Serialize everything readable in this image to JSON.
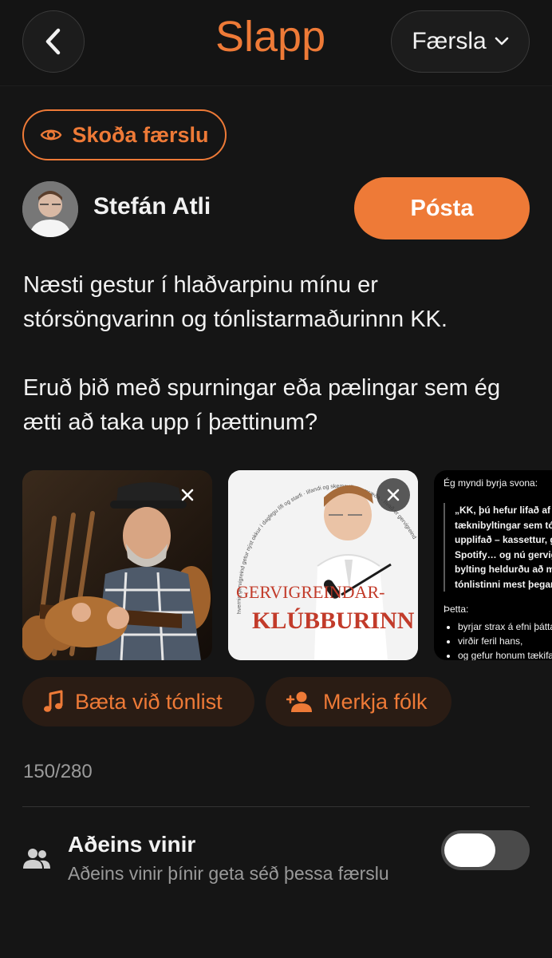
{
  "header": {
    "back_icon": "chevron-left-icon",
    "logo_text": "Slapp",
    "post_type_label": "Færsla",
    "dropdown_icon": "chevron-down-icon"
  },
  "composer": {
    "view_post_label": "Skoða færslu",
    "view_icon": "eye-icon",
    "author_name": "Stefán Atli",
    "post_button_label": "Pósta",
    "post_text": [
      "Næsti gestur í hlaðvarpinu mínu er stórsöngvarinn og tónlistarmaðurinnn KK.",
      "Eruð þið með spurningar eða pælingar sem ég ætti að taka upp í þættinum?"
    ],
    "attachments": {
      "podcast_cover": {
        "title_line1": "GERVIGREINDAR-",
        "title_line2": "KLÚBBURINN",
        "arc_text": "hvernig gervigreind getur nýst okkur í daglegu lífi og starfi · lifandi og skemmtileg umræða · hvað er gervigreind?"
      },
      "text_screenshot": {
        "intro": "Ég myndi byrja svona:",
        "quote_lines": [
          "„KK, þú hefur lifað af all",
          "tæknibyltingar sem tónl",
          "upplifað – kassettur, gei",
          "Spotify… og nú gervigre",
          "bylting heldurðu að mun",
          "tónlistinni mest þegar u"
        ],
        "after_label": "Þetta:",
        "bullets": [
          "byrjar strax á efni þátta",
          "virðir feril hans,",
          "og gefur honum tækifæ"
        ]
      }
    },
    "add_music_label": "Bæta við tónlist",
    "tag_people_label": "Merkja fólk",
    "char_count": "150/280"
  },
  "privacy": {
    "title": "Aðeins vinir",
    "description": "Aðeins vinir þínir geta séð þessa færslu",
    "friends_only": false
  },
  "colors": {
    "accent": "#ee7a37",
    "background": "#151515",
    "chip_background": "#2a1c14"
  }
}
